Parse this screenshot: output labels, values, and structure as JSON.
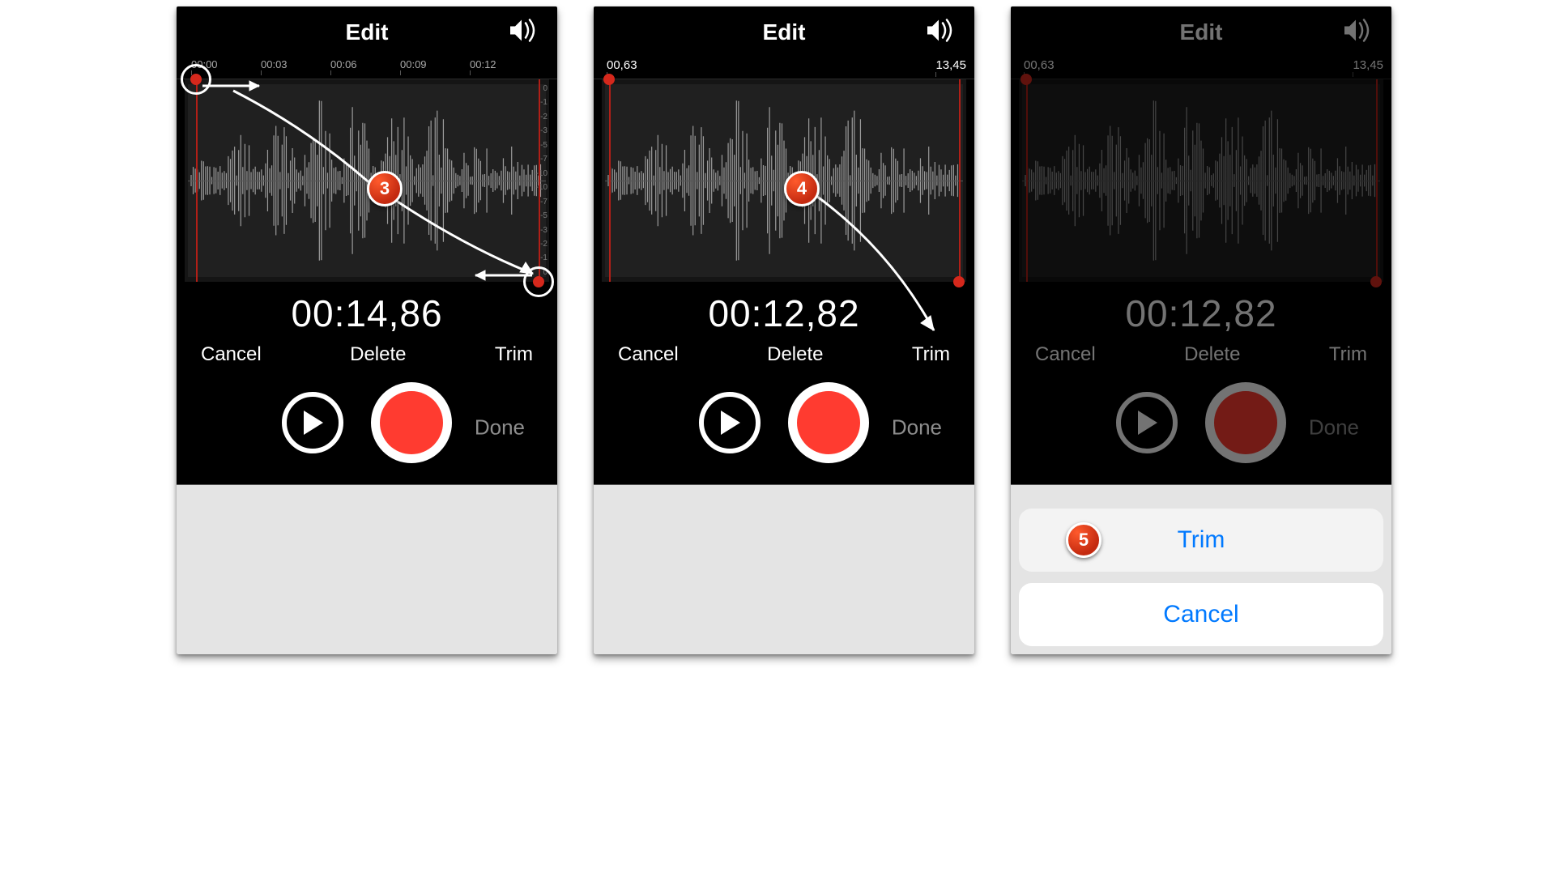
{
  "panels": [
    {
      "header": {
        "title": "Edit"
      },
      "ruler": {
        "mode": "ticks",
        "ticks": [
          "00:00",
          "00:03",
          "00:06",
          "00:09",
          "00:12"
        ]
      },
      "time": "00:14,86",
      "edit": {
        "cancel": "Cancel",
        "delete": "Delete",
        "trim": "Trim"
      },
      "done": "Done",
      "trim": {
        "left_pct": 3,
        "right_pct": 97,
        "topdot": true,
        "bottomdot": true,
        "showRings": true
      },
      "badge": {
        "num": "3",
        "top_pct": 49,
        "left_pct": 50
      }
    },
    {
      "header": {
        "title": "Edit"
      },
      "ruler": {
        "mode": "range",
        "start": "00,63",
        "end": "13,45"
      },
      "time": "00:12,82",
      "edit": {
        "cancel": "Cancel",
        "delete": "Delete",
        "trim": "Trim"
      },
      "done": "Done",
      "trim": {
        "left_pct": 2,
        "right_pct": 98,
        "topdot": false,
        "bottomdot": true,
        "showRings": false
      },
      "badge": {
        "num": "4",
        "top_pct": 49,
        "left_pct": 50
      }
    },
    {
      "header": {
        "title": "Edit"
      },
      "ruler": {
        "mode": "range",
        "start": "00,63",
        "end": "13,45"
      },
      "time": "00:12,82",
      "edit": {
        "cancel": "Cancel",
        "delete": "Delete",
        "trim": "Trim"
      },
      "done": "Done",
      "trim": {
        "left_pct": 2,
        "right_pct": 98,
        "topdot": false,
        "bottomdot": true,
        "showRings": false
      },
      "dimmed": true,
      "sheet": {
        "trim": "Trim",
        "cancel": "Cancel",
        "badge": "5"
      }
    }
  ],
  "db": [
    "0",
    "-1",
    "-2",
    "-3",
    "-5",
    "-7",
    "-10",
    "-10",
    "-7",
    "-5",
    "-3",
    "-2",
    "-1",
    "0"
  ]
}
